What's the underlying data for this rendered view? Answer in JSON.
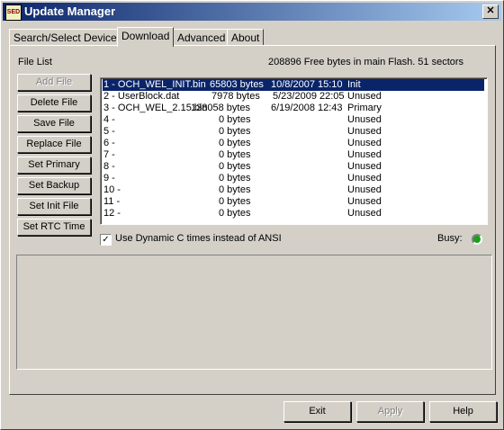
{
  "window": {
    "title": "Update Manager",
    "icon_text": "SED"
  },
  "tabs": [
    {
      "label": "Search/Select Device"
    },
    {
      "label": "Download"
    },
    {
      "label": "Advanced"
    },
    {
      "label": "About"
    }
  ],
  "download": {
    "file_list_label": "File List",
    "flash_info": "208896 Free bytes in main Flash. 51 sectors",
    "buttons": {
      "add_file": "Add File",
      "delete_file": "Delete File",
      "save_file": "Save File",
      "replace_file": "Replace File",
      "set_primary": "Set Primary",
      "set_backup": "Set Backup",
      "set_init_file": "Set Init File",
      "set_rtc_time": "Set RTC Time"
    },
    "files": [
      {
        "name": "1 - OCH_WEL_INIT.bin",
        "size": "65803 bytes",
        "date": "10/8/2007 15:10",
        "status": "Init"
      },
      {
        "name": "2 - UserBlock.dat",
        "size": "7978 bytes",
        "date": "5/23/2009 22:05",
        "status": "Unused"
      },
      {
        "name": "3 - OCH_WEL_2.15.bin",
        "size": "138058 bytes",
        "date": "6/19/2008 12:43",
        "status": "Primary"
      },
      {
        "name": "4 -",
        "size": "0 bytes",
        "date": "",
        "status": "Unused"
      },
      {
        "name": "5 -",
        "size": "0 bytes",
        "date": "",
        "status": "Unused"
      },
      {
        "name": "6 -",
        "size": "0 bytes",
        "date": "",
        "status": "Unused"
      },
      {
        "name": "7 -",
        "size": "0 bytes",
        "date": "",
        "status": "Unused"
      },
      {
        "name": "8 -",
        "size": "0 bytes",
        "date": "",
        "status": "Unused"
      },
      {
        "name": "9 -",
        "size": "0 bytes",
        "date": "",
        "status": "Unused"
      },
      {
        "name": "10 -",
        "size": "0 bytes",
        "date": "",
        "status": "Unused"
      },
      {
        "name": "11 -",
        "size": "0 bytes",
        "date": "",
        "status": "Unused"
      },
      {
        "name": "12 -",
        "size": "0 bytes",
        "date": "",
        "status": "Unused"
      }
    ],
    "dynamic_c_label": "Use Dynamic C times instead of ANSI",
    "dynamic_c_checked": true,
    "busy_label": "Busy:",
    "busy_color": "#1aa01a"
  },
  "footer": {
    "exit": "Exit",
    "apply": "Apply",
    "help": "Help"
  }
}
